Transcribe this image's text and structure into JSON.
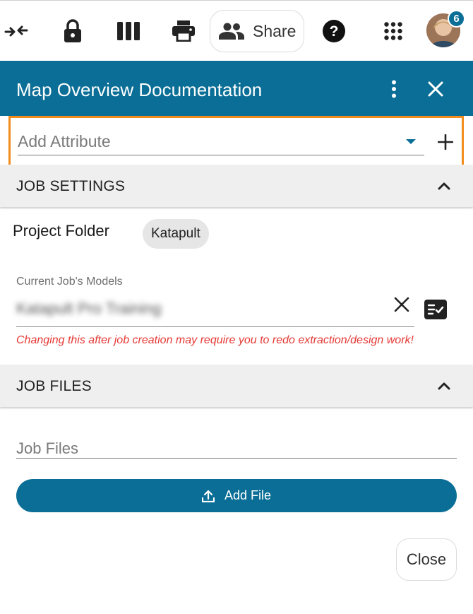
{
  "toolbar": {
    "icons": [
      "collapse-arrows-icon",
      "lock-icon",
      "columns-icon",
      "print-icon"
    ],
    "share_label": "Share",
    "share_icon": "people-icon",
    "help_icon": "help-icon",
    "apps_icon": "apps-grid-icon",
    "notification_count": "6"
  },
  "header": {
    "title": "Map Overview Documentation",
    "menu_icon": "more-vert-icon",
    "close_icon": "close-icon"
  },
  "attribute": {
    "placeholder": "Add Attribute",
    "highlight_color": "#f28c1c"
  },
  "job_settings": {
    "title": "JOB SETTINGS",
    "project_folder_label": "Project Folder",
    "project_folder_value": "Katapult",
    "models_label": "Current Job's Models",
    "models_value": "Katapult Pro Training",
    "warning": "Changing this after job creation may require you to redo extraction/design work!"
  },
  "job_files": {
    "title": "JOB FILES",
    "files_placeholder": "Job Files",
    "add_file_label": "Add File"
  },
  "footer": {
    "close_label": "Close"
  },
  "colors": {
    "primary": "#0a6e96",
    "warning": "#e53935",
    "section_bg": "#efefef"
  }
}
